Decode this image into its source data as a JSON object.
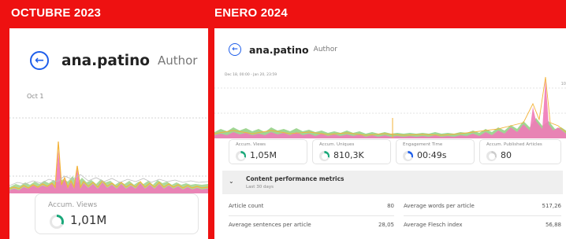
{
  "left": {
    "header": "OCTUBRE 2023",
    "author_name": "ana.patino",
    "author_role": "Author",
    "date_label": "Oct 1",
    "card": {
      "label": "Accum. Views",
      "value": "1,01M"
    }
  },
  "right": {
    "header": "ENERO 2024",
    "author_name": "ana.patino",
    "author_role": "Author",
    "date_range": "Dec 18, 00:00 - Jan 20, 23:59",
    "edge_label": "10",
    "cards": [
      {
        "label": "Accum. Views",
        "value": "1,05M",
        "ring_color": "#1aa87a",
        "fill": 0.3
      },
      {
        "label": "Accum. Uniques",
        "value": "810,3K",
        "ring_color": "#1aa87a",
        "fill": 0.3
      },
      {
        "label": "Engagement Time",
        "value": "00:49s",
        "ring_color": "#1e5eea",
        "fill": 0.3
      },
      {
        "label": "Accum. Published Articles",
        "value": "80",
        "ring_color": "#cccccc",
        "fill": 0.3
      }
    ],
    "section": {
      "title": "Content performance metrics",
      "subtitle": "Last 30 days"
    },
    "metrics": [
      {
        "label": "Article count",
        "value": "80"
      },
      {
        "label": "Average words per article",
        "value": "517,26"
      },
      {
        "label": "Average sentences per article",
        "value": "28,05"
      },
      {
        "label": "Average Flesch index",
        "value": "56,88"
      }
    ]
  },
  "colors": {
    "brand_red": "#ee1111",
    "back_blue": "#1e5eea",
    "chart_pink": "#f07ab8",
    "chart_orange": "#f3b33a",
    "chart_green": "#7cc878"
  }
}
